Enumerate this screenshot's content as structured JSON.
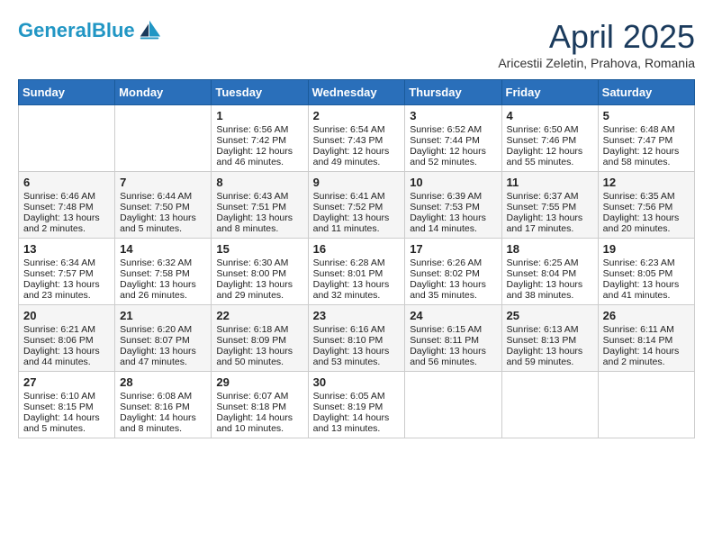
{
  "header": {
    "logo_line1": "General",
    "logo_line2": "Blue",
    "month_year": "April 2025",
    "location": "Aricestii Zeletin, Prahova, Romania"
  },
  "days_of_week": [
    "Sunday",
    "Monday",
    "Tuesday",
    "Wednesday",
    "Thursday",
    "Friday",
    "Saturday"
  ],
  "weeks": [
    [
      {
        "day": "",
        "data": ""
      },
      {
        "day": "",
        "data": ""
      },
      {
        "day": "1",
        "data": "Sunrise: 6:56 AM\nSunset: 7:42 PM\nDaylight: 12 hours and 46 minutes."
      },
      {
        "day": "2",
        "data": "Sunrise: 6:54 AM\nSunset: 7:43 PM\nDaylight: 12 hours and 49 minutes."
      },
      {
        "day": "3",
        "data": "Sunrise: 6:52 AM\nSunset: 7:44 PM\nDaylight: 12 hours and 52 minutes."
      },
      {
        "day": "4",
        "data": "Sunrise: 6:50 AM\nSunset: 7:46 PM\nDaylight: 12 hours and 55 minutes."
      },
      {
        "day": "5",
        "data": "Sunrise: 6:48 AM\nSunset: 7:47 PM\nDaylight: 12 hours and 58 minutes."
      }
    ],
    [
      {
        "day": "6",
        "data": "Sunrise: 6:46 AM\nSunset: 7:48 PM\nDaylight: 13 hours and 2 minutes."
      },
      {
        "day": "7",
        "data": "Sunrise: 6:44 AM\nSunset: 7:50 PM\nDaylight: 13 hours and 5 minutes."
      },
      {
        "day": "8",
        "data": "Sunrise: 6:43 AM\nSunset: 7:51 PM\nDaylight: 13 hours and 8 minutes."
      },
      {
        "day": "9",
        "data": "Sunrise: 6:41 AM\nSunset: 7:52 PM\nDaylight: 13 hours and 11 minutes."
      },
      {
        "day": "10",
        "data": "Sunrise: 6:39 AM\nSunset: 7:53 PM\nDaylight: 13 hours and 14 minutes."
      },
      {
        "day": "11",
        "data": "Sunrise: 6:37 AM\nSunset: 7:55 PM\nDaylight: 13 hours and 17 minutes."
      },
      {
        "day": "12",
        "data": "Sunrise: 6:35 AM\nSunset: 7:56 PM\nDaylight: 13 hours and 20 minutes."
      }
    ],
    [
      {
        "day": "13",
        "data": "Sunrise: 6:34 AM\nSunset: 7:57 PM\nDaylight: 13 hours and 23 minutes."
      },
      {
        "day": "14",
        "data": "Sunrise: 6:32 AM\nSunset: 7:58 PM\nDaylight: 13 hours and 26 minutes."
      },
      {
        "day": "15",
        "data": "Sunrise: 6:30 AM\nSunset: 8:00 PM\nDaylight: 13 hours and 29 minutes."
      },
      {
        "day": "16",
        "data": "Sunrise: 6:28 AM\nSunset: 8:01 PM\nDaylight: 13 hours and 32 minutes."
      },
      {
        "day": "17",
        "data": "Sunrise: 6:26 AM\nSunset: 8:02 PM\nDaylight: 13 hours and 35 minutes."
      },
      {
        "day": "18",
        "data": "Sunrise: 6:25 AM\nSunset: 8:04 PM\nDaylight: 13 hours and 38 minutes."
      },
      {
        "day": "19",
        "data": "Sunrise: 6:23 AM\nSunset: 8:05 PM\nDaylight: 13 hours and 41 minutes."
      }
    ],
    [
      {
        "day": "20",
        "data": "Sunrise: 6:21 AM\nSunset: 8:06 PM\nDaylight: 13 hours and 44 minutes."
      },
      {
        "day": "21",
        "data": "Sunrise: 6:20 AM\nSunset: 8:07 PM\nDaylight: 13 hours and 47 minutes."
      },
      {
        "day": "22",
        "data": "Sunrise: 6:18 AM\nSunset: 8:09 PM\nDaylight: 13 hours and 50 minutes."
      },
      {
        "day": "23",
        "data": "Sunrise: 6:16 AM\nSunset: 8:10 PM\nDaylight: 13 hours and 53 minutes."
      },
      {
        "day": "24",
        "data": "Sunrise: 6:15 AM\nSunset: 8:11 PM\nDaylight: 13 hours and 56 minutes."
      },
      {
        "day": "25",
        "data": "Sunrise: 6:13 AM\nSunset: 8:13 PM\nDaylight: 13 hours and 59 minutes."
      },
      {
        "day": "26",
        "data": "Sunrise: 6:11 AM\nSunset: 8:14 PM\nDaylight: 14 hours and 2 minutes."
      }
    ],
    [
      {
        "day": "27",
        "data": "Sunrise: 6:10 AM\nSunset: 8:15 PM\nDaylight: 14 hours and 5 minutes."
      },
      {
        "day": "28",
        "data": "Sunrise: 6:08 AM\nSunset: 8:16 PM\nDaylight: 14 hours and 8 minutes."
      },
      {
        "day": "29",
        "data": "Sunrise: 6:07 AM\nSunset: 8:18 PM\nDaylight: 14 hours and 10 minutes."
      },
      {
        "day": "30",
        "data": "Sunrise: 6:05 AM\nSunset: 8:19 PM\nDaylight: 14 hours and 13 minutes."
      },
      {
        "day": "",
        "data": ""
      },
      {
        "day": "",
        "data": ""
      },
      {
        "day": "",
        "data": ""
      }
    ]
  ]
}
